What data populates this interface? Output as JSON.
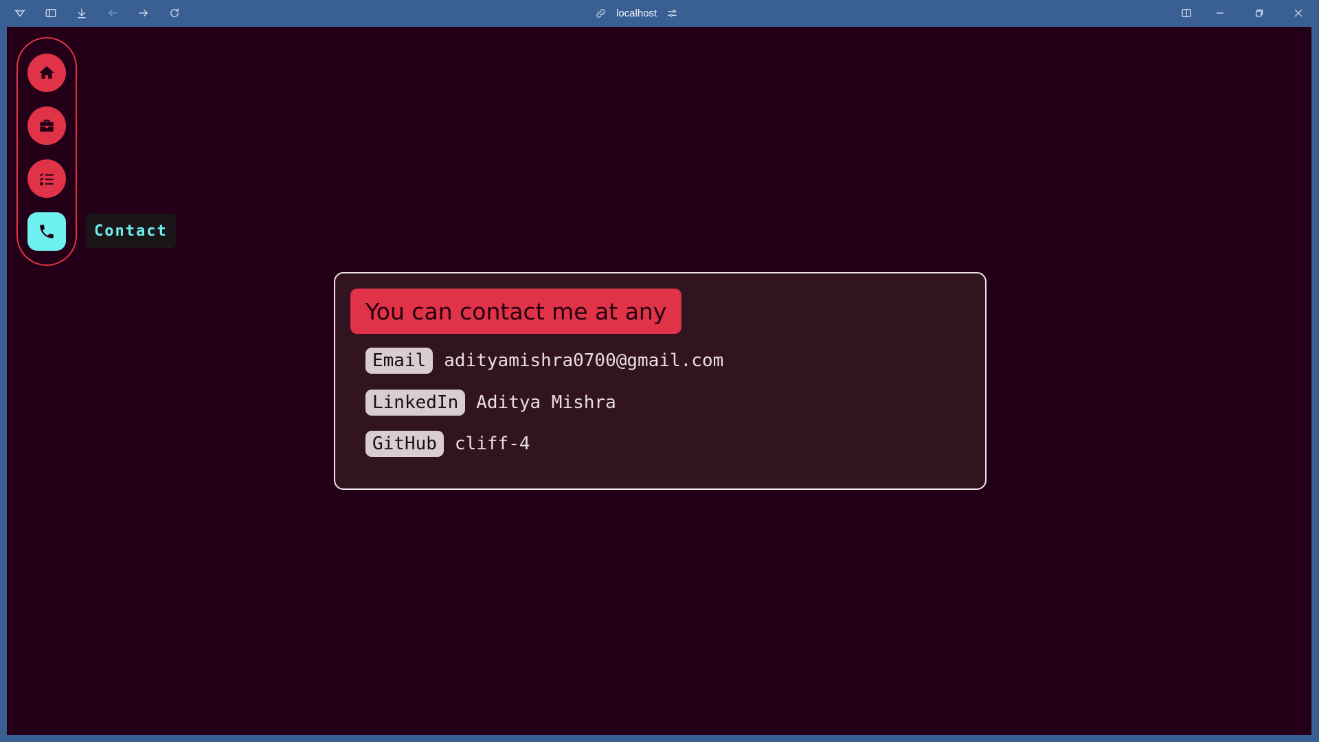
{
  "browser": {
    "url": "localhost",
    "icons": {
      "logo": "vivaldi-logo-icon",
      "sidebar": "sidebar-toggle-icon",
      "download": "download-icon",
      "back": "arrow-left-icon",
      "forward": "arrow-right-icon",
      "reload": "reload-icon",
      "link": "link-icon",
      "site_settings": "sliders-icon",
      "split_view": "split-view-icon",
      "minimize": "minimize-icon",
      "restore": "restore-icon",
      "close": "close-icon"
    }
  },
  "nav": {
    "items": [
      {
        "icon": "home-icon"
      },
      {
        "icon": "briefcase-icon"
      },
      {
        "icon": "checklist-icon"
      },
      {
        "icon": "phone-icon",
        "active": true
      }
    ],
    "tooltip": "Contact"
  },
  "contact": {
    "heading": "You can contact me at any",
    "rows": [
      {
        "label": "Email",
        "value": "adityamishra0700@gmail.com"
      },
      {
        "label": "LinkedIn",
        "value": "Aditya Mishra"
      },
      {
        "label": "GitHub",
        "value": "cliff-4"
      }
    ]
  },
  "colors": {
    "accent": "#e03347",
    "active": "#6ff0f0",
    "background": "#230017",
    "card": "#311420",
    "chrome": "#3a5f93"
  }
}
